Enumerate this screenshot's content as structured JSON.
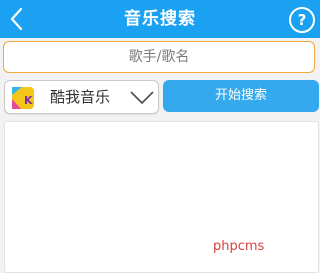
{
  "header": {
    "title": "音乐搜索",
    "help_symbol": "?",
    "back_icon": "chevron-left-icon",
    "bg_color": "#1ba1f2"
  },
  "search": {
    "placeholder": "歌手/歌名",
    "value": "",
    "border_color": "#f0a93a"
  },
  "source": {
    "selected": "酷我音乐",
    "logo_icon": "kuwo-logo-icon"
  },
  "actions": {
    "search_label": "开始搜索",
    "button_color": "#34a9ee"
  },
  "watermark": {
    "text": "phpcms",
    "color": "#d63f3f"
  }
}
